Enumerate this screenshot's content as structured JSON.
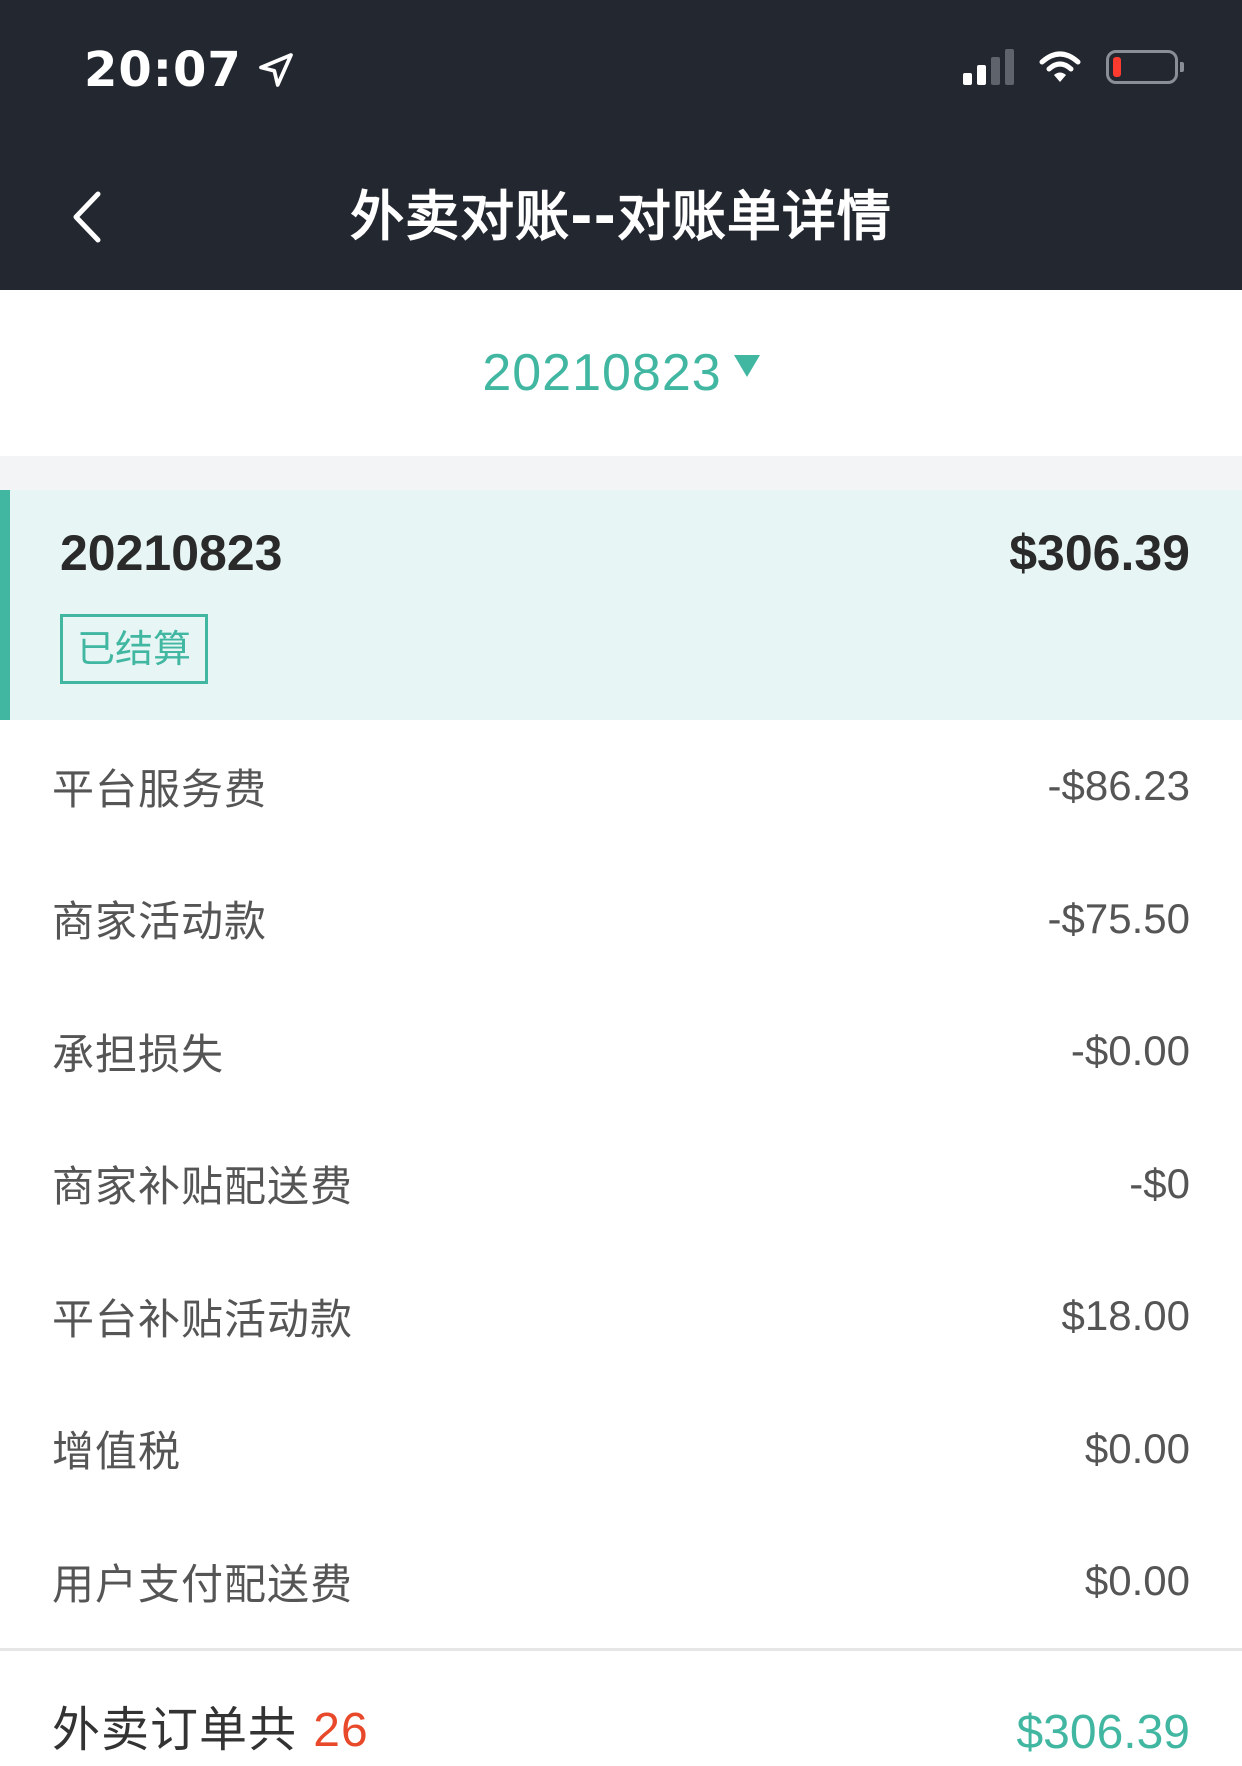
{
  "status_bar": {
    "time": "20:07"
  },
  "nav": {
    "title": "外卖对账--对账单详情"
  },
  "date_selector": {
    "value": "20210823"
  },
  "summary": {
    "date": "20210823",
    "amount": "$306.39",
    "status": "已结算"
  },
  "rows": [
    {
      "label": "平台服务费",
      "value": "-$86.23"
    },
    {
      "label": "商家活动款",
      "value": "-$75.50"
    },
    {
      "label": "承担损失",
      "value": "-$0.00"
    },
    {
      "label": "商家补贴配送费",
      "value": "-$0"
    },
    {
      "label": "平台补贴活动款",
      "value": "$18.00"
    },
    {
      "label": "增值税",
      "value": "$0.00"
    },
    {
      "label": "用户支付配送费",
      "value": "$0.00"
    }
  ],
  "footer": {
    "prefix": "外卖订单共 ",
    "count": "26",
    "total": "$306.39"
  },
  "colors": {
    "header_bg": "#232730",
    "accent": "#41b7a2",
    "card_bg": "#e7f6f4",
    "count_red": "#e8492a",
    "battery_low": "#ff3b30"
  },
  "icons": {
    "back": "chevron-left-icon",
    "location": "location-arrow-icon",
    "signal": "cellular-signal-icon",
    "wifi": "wifi-icon",
    "battery": "battery-low-icon",
    "dropdown": "triangle-down-icon"
  }
}
